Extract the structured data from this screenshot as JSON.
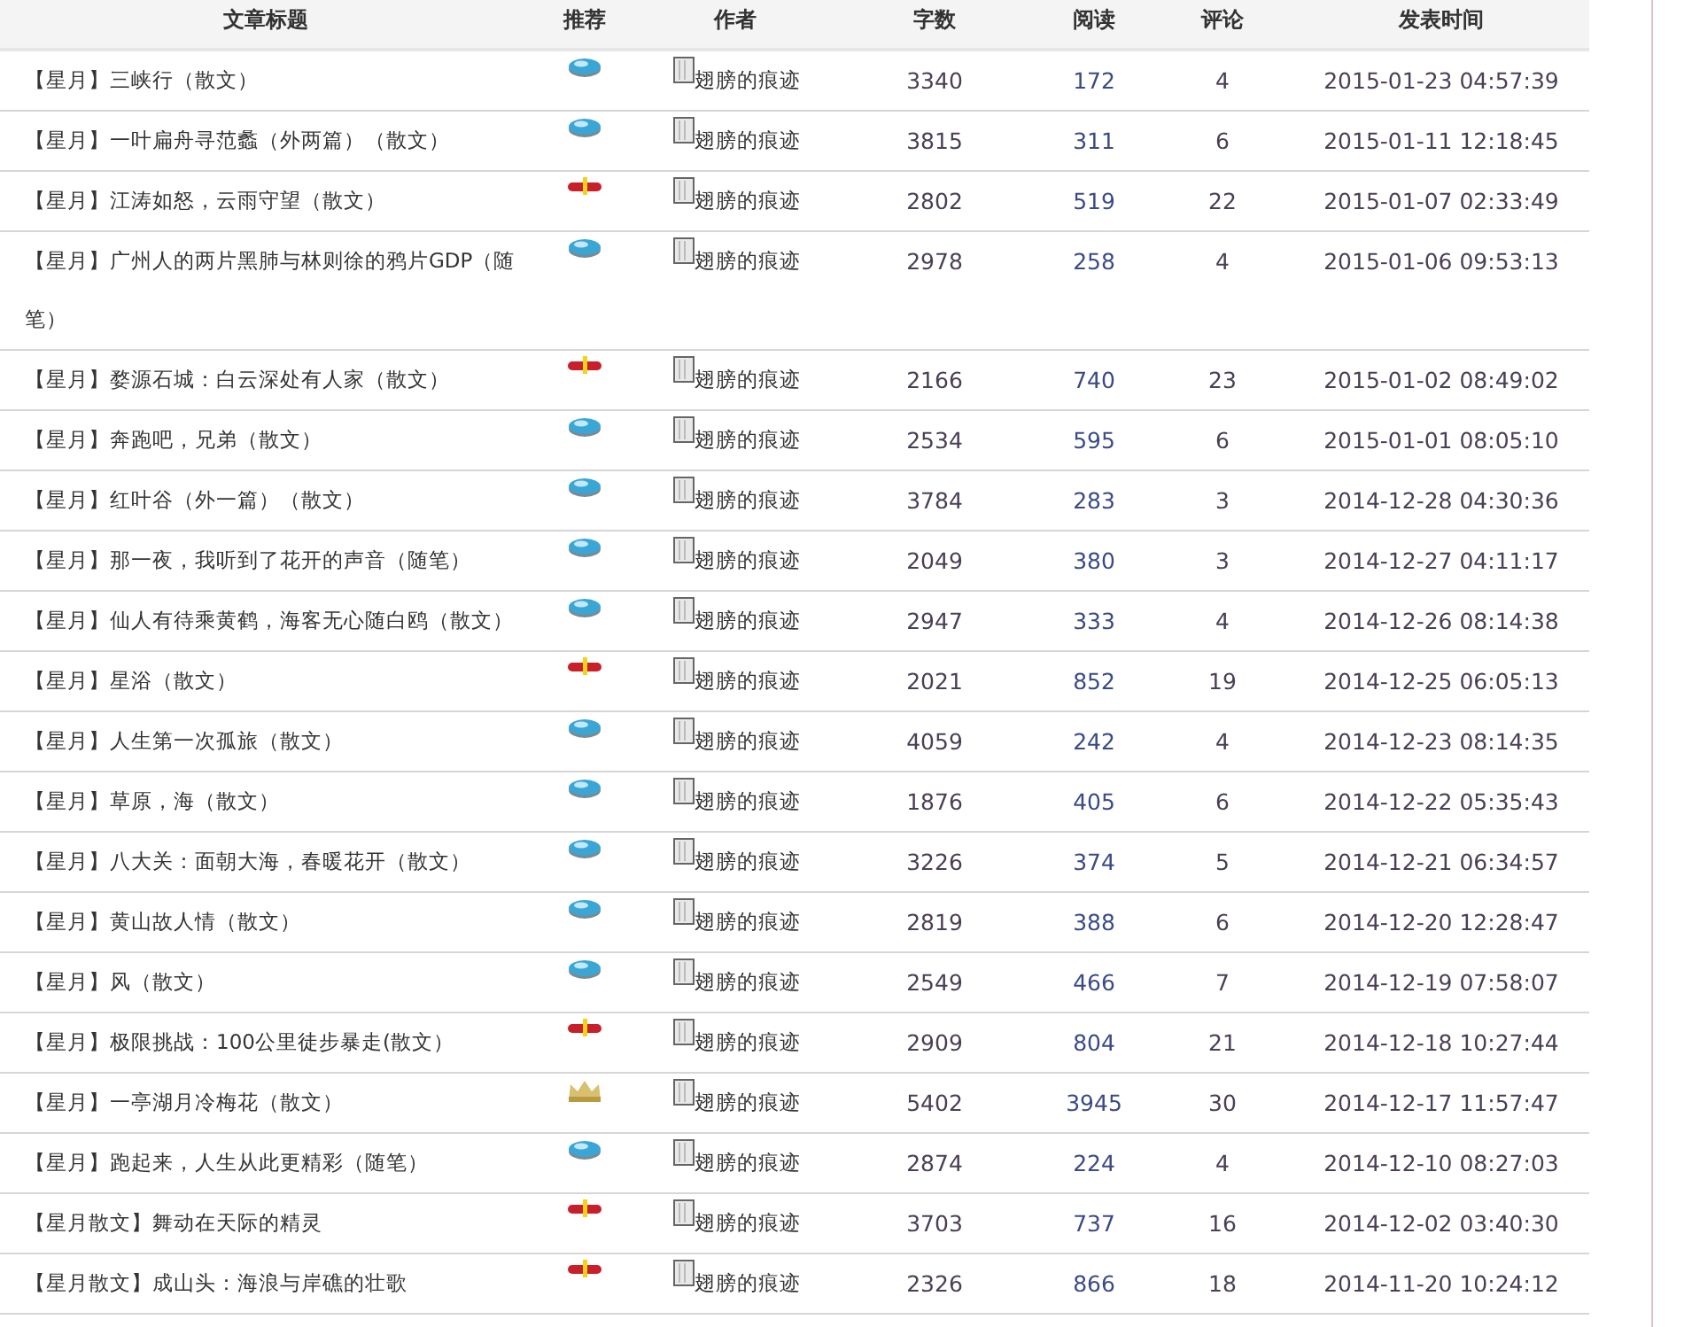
{
  "table": {
    "columns": [
      "文章标题",
      "推荐",
      "作者",
      "字数",
      "阅读",
      "评论",
      "发表时间"
    ],
    "rows": [
      {
        "title": "【星月】三峡行（散文）",
        "recommend": {
          "kind": "gem"
        },
        "author": "翅膀的痕迹",
        "words": "3340",
        "reads": "172",
        "comments": "4",
        "time": "2015-01-23 04:57:39"
      },
      {
        "title": "【星月】一叶扁舟寻范蠡（外两篇）（散文）",
        "recommend": {
          "kind": "gem"
        },
        "author": "翅膀的痕迹",
        "words": "3815",
        "reads": "311",
        "comments": "6",
        "time": "2015-01-11 12:18:45"
      },
      {
        "title": "【星月】江涛如怒，云雨守望（散文）",
        "recommend": {
          "kind": "badge"
        },
        "author": "翅膀的痕迹",
        "words": "2802",
        "reads": "519",
        "comments": "22",
        "time": "2015-01-07 02:33:49"
      },
      {
        "title": "【星月】广州人的两片黑肺与林则徐的鸦片GDP（随笔）",
        "recommend": {
          "kind": "gem"
        },
        "author": "翅膀的痕迹",
        "words": "2978",
        "reads": "258",
        "comments": "4",
        "time": "2015-01-06 09:53:13"
      },
      {
        "title": "【星月】婺源石城：白云深处有人家（散文）",
        "recommend": {
          "kind": "badge"
        },
        "author": "翅膀的痕迹",
        "words": "2166",
        "reads": "740",
        "comments": "23",
        "time": "2015-01-02 08:49:02"
      },
      {
        "title": "【星月】奔跑吧，兄弟（散文）",
        "recommend": {
          "kind": "gem"
        },
        "author": "翅膀的痕迹",
        "words": "2534",
        "reads": "595",
        "comments": "6",
        "time": "2015-01-01 08:05:10"
      },
      {
        "title": "【星月】红叶谷（外一篇）（散文）",
        "recommend": {
          "kind": "gem"
        },
        "author": "翅膀的痕迹",
        "words": "3784",
        "reads": "283",
        "comments": "3",
        "time": "2014-12-28 04:30:36"
      },
      {
        "title": "【星月】那一夜，我听到了花开的声音（随笔）",
        "recommend": {
          "kind": "gem"
        },
        "author": "翅膀的痕迹",
        "words": "2049",
        "reads": "380",
        "comments": "3",
        "time": "2014-12-27 04:11:17"
      },
      {
        "title": "【星月】仙人有待乘黄鹤，海客无心随白鸥（散文）",
        "recommend": {
          "kind": "gem"
        },
        "author": "翅膀的痕迹",
        "words": "2947",
        "reads": "333",
        "comments": "4",
        "time": "2014-12-26 08:14:38"
      },
      {
        "title": "【星月】星浴（散文）",
        "recommend": {
          "kind": "badge"
        },
        "author": "翅膀的痕迹",
        "words": "2021",
        "reads": "852",
        "comments": "19",
        "time": "2014-12-25 06:05:13"
      },
      {
        "title": "【星月】人生第一次孤旅（散文）",
        "recommend": {
          "kind": "gem"
        },
        "author": "翅膀的痕迹",
        "words": "4059",
        "reads": "242",
        "comments": "4",
        "time": "2014-12-23 08:14:35"
      },
      {
        "title": "【星月】草原，海（散文）",
        "recommend": {
          "kind": "gem"
        },
        "author": "翅膀的痕迹",
        "words": "1876",
        "reads": "405",
        "comments": "6",
        "time": "2014-12-22 05:35:43"
      },
      {
        "title": "【星月】八大关：面朝大海，春暖花开（散文）",
        "recommend": {
          "kind": "gem"
        },
        "author": "翅膀的痕迹",
        "words": "3226",
        "reads": "374",
        "comments": "5",
        "time": "2014-12-21 06:34:57"
      },
      {
        "title": "【星月】黄山故人情（散文）",
        "recommend": {
          "kind": "gem"
        },
        "author": "翅膀的痕迹",
        "words": "2819",
        "reads": "388",
        "comments": "6",
        "time": "2014-12-20 12:28:47"
      },
      {
        "title": "【星月】风（散文）",
        "recommend": {
          "kind": "gem"
        },
        "author": "翅膀的痕迹",
        "words": "2549",
        "reads": "466",
        "comments": "7",
        "time": "2014-12-19 07:58:07"
      },
      {
        "title": "【星月】极限挑战：100公里徒步暴走(散文）",
        "recommend": {
          "kind": "badge"
        },
        "author": "翅膀的痕迹",
        "words": "2909",
        "reads": "804",
        "comments": "21",
        "time": "2014-12-18 10:27:44"
      },
      {
        "title": "【星月】一亭湖月冷梅花（散文）",
        "recommend": {
          "kind": "crown"
        },
        "author": "翅膀的痕迹",
        "words": "5402",
        "reads": "3945",
        "comments": "30",
        "time": "2014-12-17 11:57:47"
      },
      {
        "title": "【星月】跑起来，人生从此更精彩（随笔）",
        "recommend": {
          "kind": "gem"
        },
        "author": "翅膀的痕迹",
        "words": "2874",
        "reads": "224",
        "comments": "4",
        "time": "2014-12-10 08:27:03"
      },
      {
        "title": "【星月散文】舞动在天际的精灵",
        "recommend": {
          "kind": "badge"
        },
        "author": "翅膀的痕迹",
        "words": "3703",
        "reads": "737",
        "comments": "16",
        "time": "2014-12-02 03:40:30"
      },
      {
        "title": "【星月散文】成山头：海浪与岸礁的壮歌",
        "recommend": {
          "kind": "badge"
        },
        "author": "翅膀的痕迹",
        "words": "2326",
        "reads": "866",
        "comments": "18",
        "time": "2014-11-20 10:24:12"
      }
    ]
  }
}
